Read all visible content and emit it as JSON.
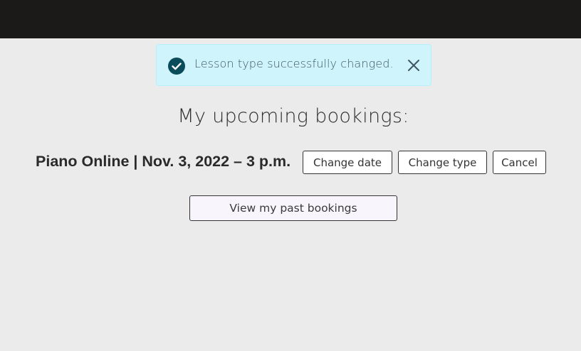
{
  "alert": {
    "message": "Lesson type successfully changed.",
    "icon": "check-circle-icon",
    "close_icon": "close-icon",
    "bg_color": "#cff4fc",
    "icon_color": "#0a4c5a"
  },
  "main": {
    "heading": "My upcoming bookings:",
    "bookings": [
      {
        "title": "Piano Online | Nov. 3, 2022 – 3 p.m.",
        "actions": {
          "change_date": "Change date",
          "change_type": "Change type",
          "cancel": "Cancel"
        }
      }
    ],
    "past_bookings_label": "View my past bookings"
  },
  "colors": {
    "topbar": "#1c1a19",
    "page_bg": "#ebebeb"
  }
}
